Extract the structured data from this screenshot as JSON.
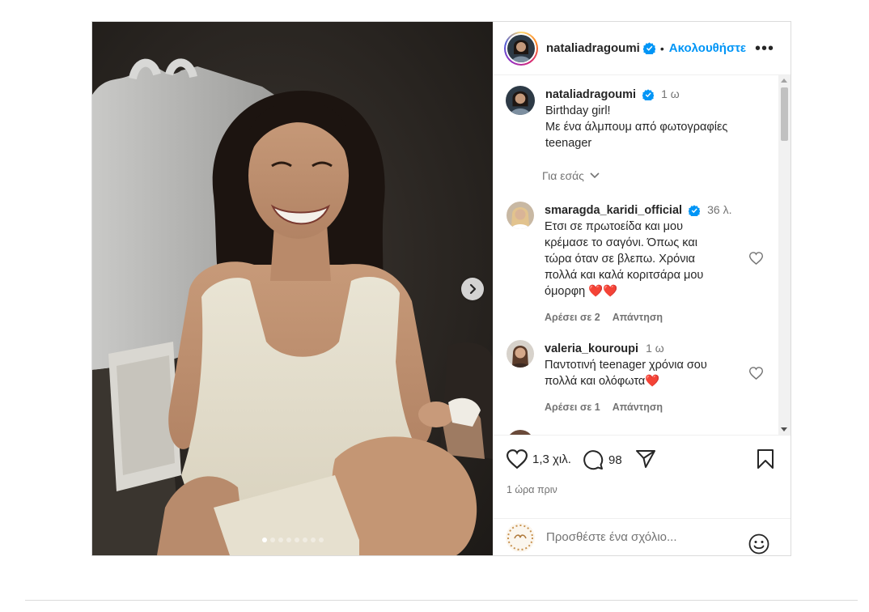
{
  "post": {
    "author": "nataliadragoumi",
    "separator": "•",
    "follow_label": "Ακολουθήστε",
    "more_label": "•••",
    "caption": {
      "username": "nataliadragoumi",
      "time": "1 ω",
      "lines": [
        "Birthday girl!",
        "Με ένα άλμπουμ από φωτογραφίες",
        "teenager"
      ]
    },
    "for_you_label": "Για εσάς",
    "carousel": {
      "total_images": 8,
      "current": 1
    }
  },
  "comments": [
    {
      "username": "smaragda_karidi_official",
      "verified": true,
      "time": "36 λ.",
      "lines": [
        "Ετσι σε πρωτοείδα και μου",
        "κρέμασε το σαγόνι. Όπως και",
        "τώρα όταν σε βλεπω. Χρόνια",
        "πολλά και καλά κοριτσάρα μου",
        "όμορφη ❤️❤️"
      ],
      "likes_label": "Αρέσει σε 2",
      "reply_label": "Απάντηση"
    },
    {
      "username": "valeria_kouroupi",
      "verified": false,
      "time": "1 ω",
      "lines": [
        "Παντοτινή teenager χρόνια σου",
        "πολλά και ολόφωτα❤️"
      ],
      "likes_label": "Αρέσει σε 1",
      "reply_label": "Απάντηση"
    }
  ],
  "actions": {
    "likes": "1,3 χιλ.",
    "comments": "98",
    "posted_ago": "1 ώρα πριν"
  },
  "add_comment": {
    "placeholder": "Προσθέστε ένα σχόλιο..."
  },
  "colors": {
    "link": "#0095f6",
    "verified": "#0095f6",
    "muted": "#737373",
    "text": "#262626"
  }
}
